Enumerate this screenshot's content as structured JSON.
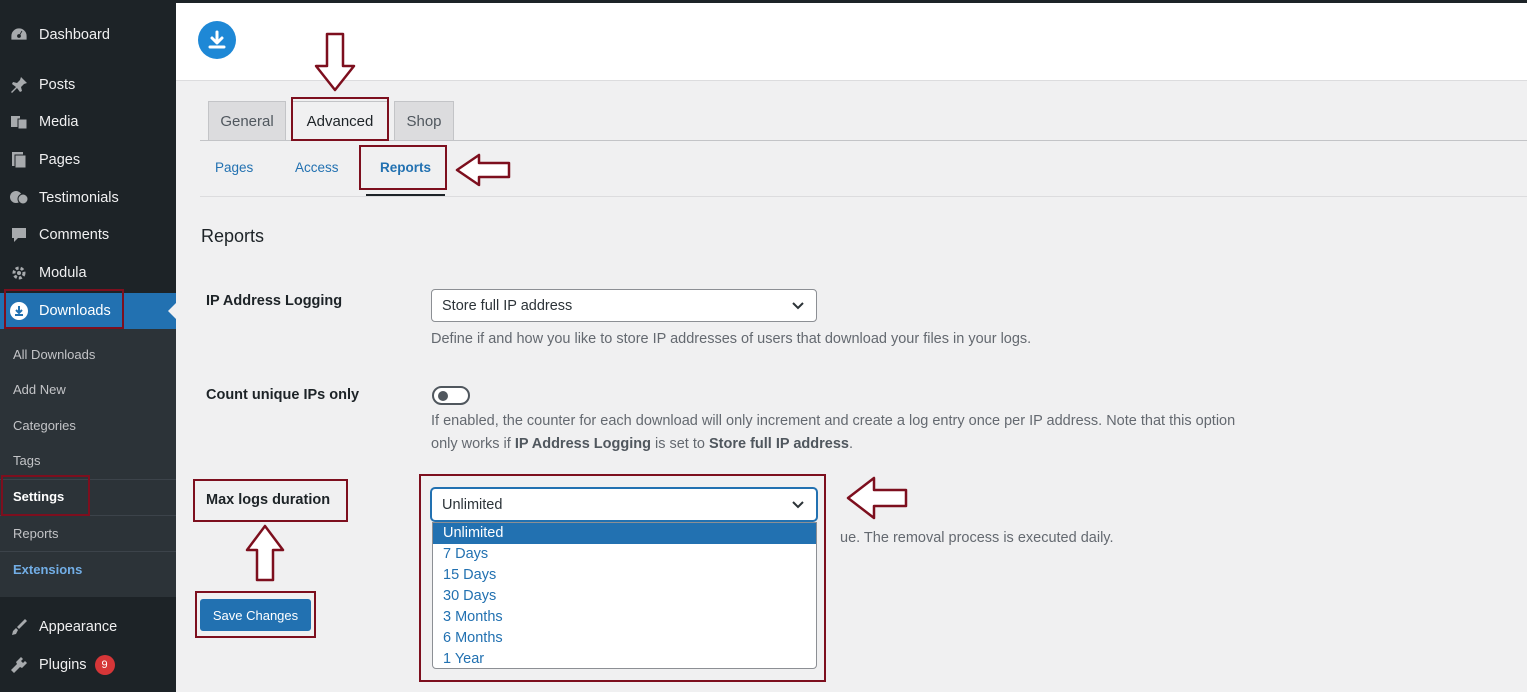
{
  "sidebar": {
    "items": [
      {
        "label": "Dashboard",
        "icon": "dashboard-icon"
      },
      {
        "label": "Posts",
        "icon": "pin-icon"
      },
      {
        "label": "Media",
        "icon": "media-icon"
      },
      {
        "label": "Pages",
        "icon": "pages-icon"
      },
      {
        "label": "Testimonials",
        "icon": "testimonials-icon"
      },
      {
        "label": "Comments",
        "icon": "comment-icon"
      },
      {
        "label": "Modula",
        "icon": "gear-icon"
      },
      {
        "label": "Downloads",
        "icon": "download-icon"
      },
      {
        "label": "Appearance",
        "icon": "brush-icon"
      },
      {
        "label": "Plugins",
        "icon": "plugin-icon"
      }
    ],
    "plugins_badge": "9",
    "submenu": [
      "All Downloads",
      "Add New",
      "Categories",
      "Tags",
      "Settings",
      "Reports",
      "Extensions"
    ]
  },
  "tabs": [
    "General",
    "Advanced",
    "Shop"
  ],
  "subtabs": [
    "Pages",
    "Access",
    "Reports"
  ],
  "section_title": "Reports",
  "fields": {
    "ip_logging": {
      "label": "IP Address Logging",
      "value": "Store full IP address",
      "description": "Define if and how you like to store IP addresses of users that download your files in your logs."
    },
    "unique_ips": {
      "label": "Count unique IPs only",
      "enabled": false,
      "description_line1": "If enabled, the counter for each download will only increment and create a log entry once per IP address. Note that this option",
      "description_pre": "only works if ",
      "description_b1": "IP Address Logging",
      "description_mid": " is set to ",
      "description_b2": "Store full IP address",
      "description_end": "."
    },
    "max_logs": {
      "label": "Max logs duration",
      "value": "Unlimited",
      "description_visible": "ue. The removal process is executed daily.",
      "options": [
        "Unlimited",
        "7 Days",
        "15 Days",
        "30 Days",
        "3 Months",
        "6 Months",
        "1 Year"
      ],
      "selected": "Unlimited"
    }
  },
  "save_button": "Save Changes",
  "colors": {
    "accent": "#2271b1",
    "sidebar": "#1d2327",
    "annotation": "#7d0f1e"
  }
}
